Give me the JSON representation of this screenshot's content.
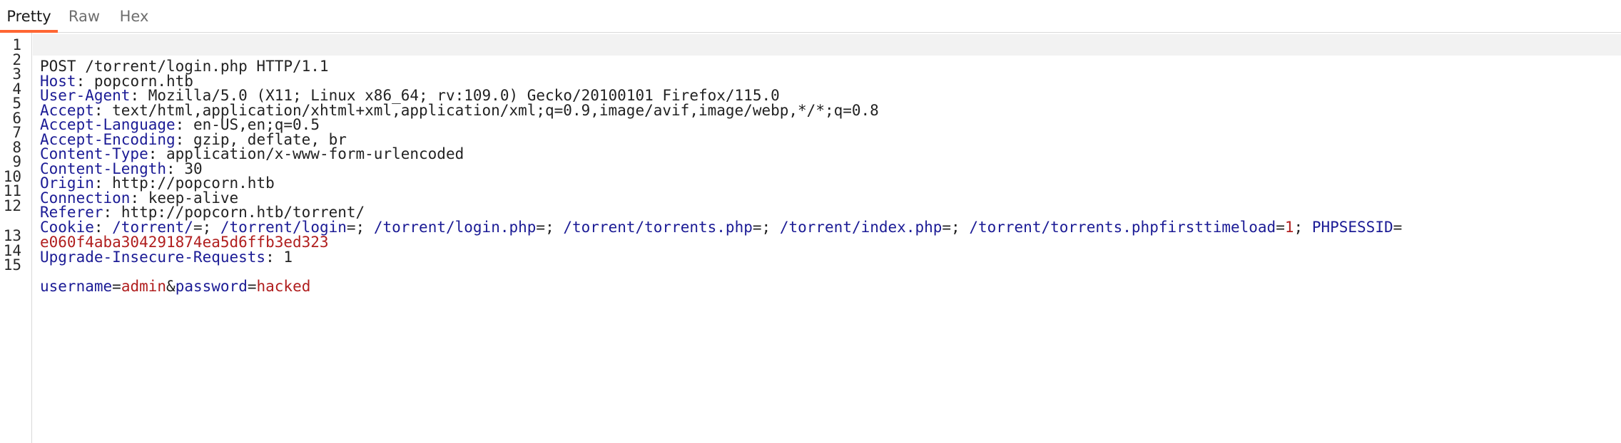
{
  "tabs": [
    {
      "label": "Pretty",
      "active": true
    },
    {
      "label": "Raw",
      "active": false
    },
    {
      "label": "Hex",
      "active": false
    }
  ],
  "line_numbers": [
    "1",
    "2",
    "3",
    "4",
    "5",
    "6",
    "7",
    "8",
    "9",
    "10",
    "11",
    "12",
    "13",
    "14",
    "15"
  ],
  "request": {
    "request_line": "POST /torrent/login.php HTTP/1.1",
    "headers": [
      {
        "name": "Host",
        "value": "popcorn.htb"
      },
      {
        "name": "User-Agent",
        "value": "Mozilla/5.0 (X11; Linux x86_64; rv:109.0) Gecko/20100101 Firefox/115.0"
      },
      {
        "name": "Accept",
        "value": "text/html,application/xhtml+xml,application/xml;q=0.9,image/avif,image/webp,*/*;q=0.8"
      },
      {
        "name": "Accept-Language",
        "value": "en-US,en;q=0.5"
      },
      {
        "name": "Accept-Encoding",
        "value": "gzip, deflate, br"
      },
      {
        "name": "Content-Type",
        "value": "application/x-www-form-urlencoded"
      },
      {
        "name": "Content-Length",
        "value": "30"
      },
      {
        "name": "Origin",
        "value": "http://popcorn.htb"
      },
      {
        "name": "Connection",
        "value": "keep-alive"
      },
      {
        "name": "Referer",
        "value": "http://popcorn.htb/torrent/"
      }
    ],
    "cookie_header": "Cookie",
    "cookies": [
      {
        "name": "/torrent/",
        "value": ""
      },
      {
        "name": "/torrent/login",
        "value": ""
      },
      {
        "name": "/torrent/login.php",
        "value": ""
      },
      {
        "name": "/torrent/torrents.php",
        "value": ""
      },
      {
        "name": "/torrent/index.php",
        "value": ""
      },
      {
        "name": "/torrent/torrents.phpfirsttimeload",
        "value": "1"
      },
      {
        "name": "PHPSESSID",
        "value": "e060f4aba304291874ea5d6ffb3ed323"
      }
    ],
    "after_cookie_header": {
      "name": "Upgrade-Insecure-Requests",
      "value": "1"
    },
    "body_params": [
      {
        "name": "username",
        "value": "admin"
      },
      {
        "name": "password",
        "value": "hacked"
      }
    ]
  }
}
